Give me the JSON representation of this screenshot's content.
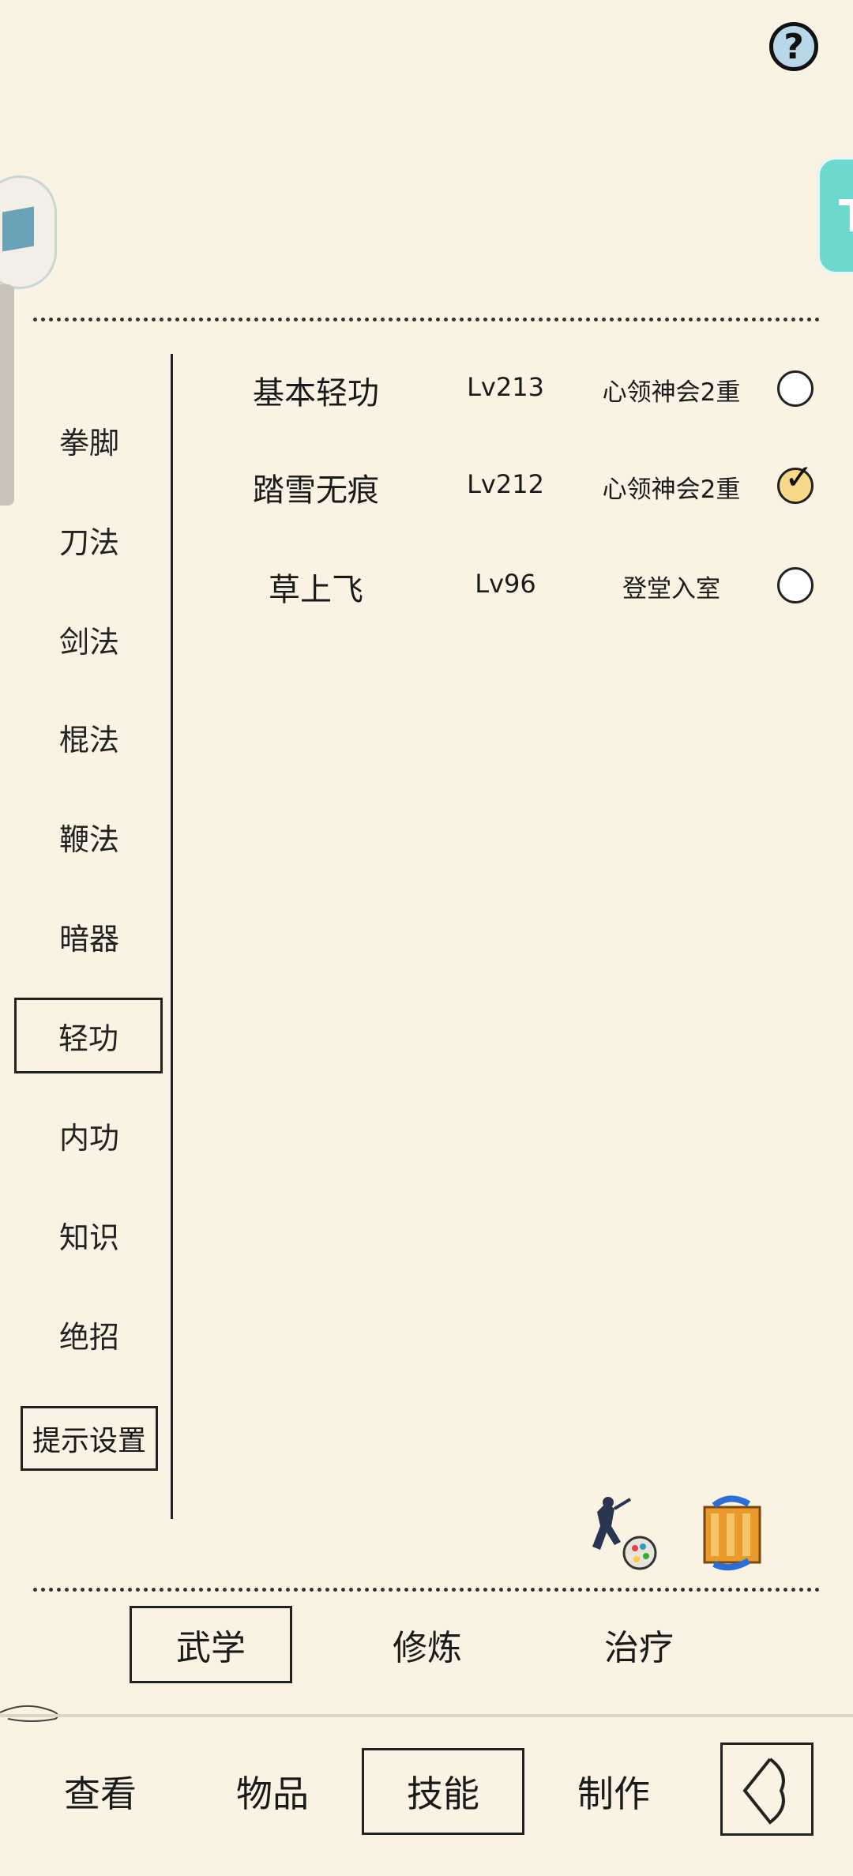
{
  "categories": [
    {
      "label": "拳脚"
    },
    {
      "label": "刀法"
    },
    {
      "label": "剑法"
    },
    {
      "label": "棍法"
    },
    {
      "label": "鞭法"
    },
    {
      "label": "暗器"
    },
    {
      "label": "轻功",
      "active": true
    },
    {
      "label": "内功"
    },
    {
      "label": "知识"
    },
    {
      "label": "绝招"
    }
  ],
  "hint_settings_label": "提示设置",
  "skills": [
    {
      "name": "基本轻功",
      "level": "Lv213",
      "rank": "心领神会2重",
      "selected": false
    },
    {
      "name": "踏雪无痕",
      "level": "Lv212",
      "rank": "心领神会2重",
      "selected": true
    },
    {
      "name": "草上飞",
      "level": "Lv96",
      "rank": "登堂入室",
      "selected": false
    }
  ],
  "sub_tabs": [
    {
      "label": "武学",
      "active": true
    },
    {
      "label": "修炼"
    },
    {
      "label": "治疗"
    }
  ],
  "nav_tabs": [
    {
      "label": "查看"
    },
    {
      "label": "物品"
    },
    {
      "label": "技能",
      "active": true
    },
    {
      "label": "制作"
    }
  ],
  "help_icon": "question-icon",
  "colors": {
    "background": "#faf3e3",
    "checked_fill": "#f7d987",
    "help_fill": "#b8d8ea",
    "float_right": "#6dd8cd"
  }
}
